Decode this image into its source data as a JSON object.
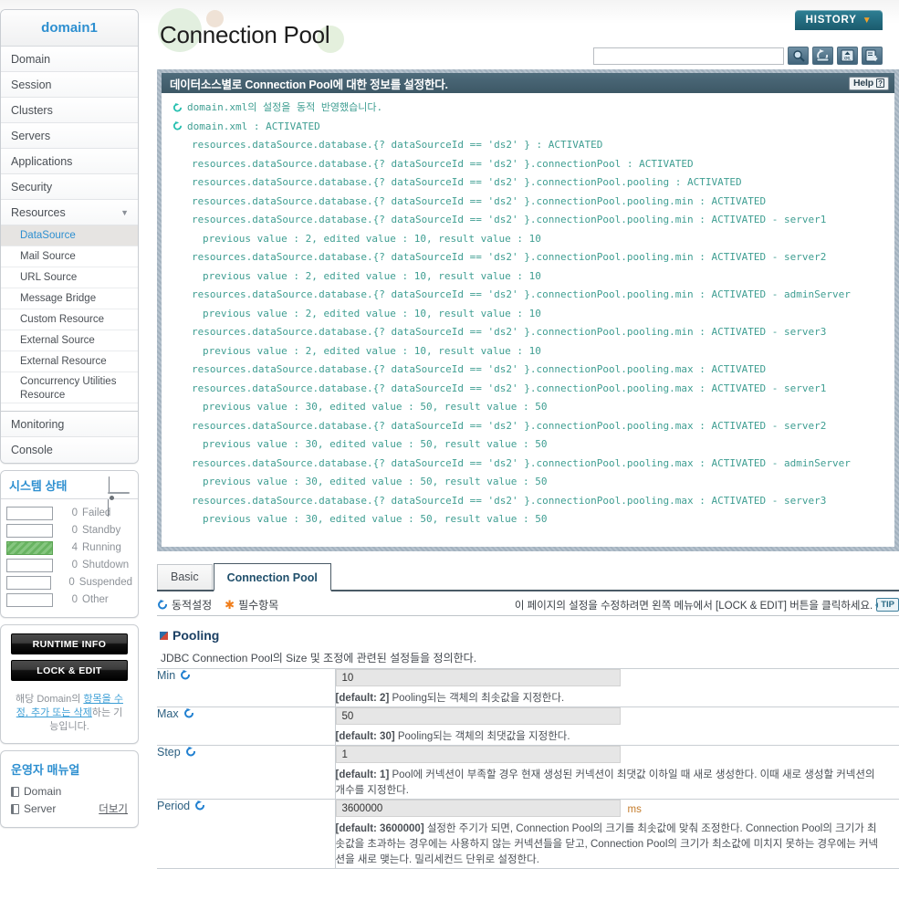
{
  "sidebar": {
    "domain_title": "domain1",
    "nav": [
      {
        "label": "Domain"
      },
      {
        "label": "Session"
      },
      {
        "label": "Clusters"
      },
      {
        "label": "Servers"
      },
      {
        "label": "Applications"
      },
      {
        "label": "Security"
      },
      {
        "label": "Resources",
        "expanded": true,
        "chevron": "chevron-down-icon"
      }
    ],
    "resources_sub": [
      {
        "label": "DataSource",
        "active": true
      },
      {
        "label": "Mail Source",
        "active": false
      },
      {
        "label": "URL Source",
        "active": false
      },
      {
        "label": "Message Bridge",
        "active": false
      },
      {
        "label": "Custom Resource",
        "active": false
      },
      {
        "label": "External Source",
        "active": false
      },
      {
        "label": "External Resource",
        "active": false
      },
      {
        "label": "Concurrency Utilities Resource",
        "active": false
      }
    ],
    "nav_tail": [
      {
        "label": "Monitoring"
      },
      {
        "label": "Console"
      }
    ],
    "system_status": {
      "title": "시스템 상태",
      "icon": "laptop-icon",
      "rows": [
        {
          "count": "0",
          "label": "Failed",
          "filled": false
        },
        {
          "count": "0",
          "label": "Standby",
          "filled": false
        },
        {
          "count": "4",
          "label": "Running",
          "filled": true
        },
        {
          "count": "0",
          "label": "Shutdown",
          "filled": false
        },
        {
          "count": "0",
          "label": "Suspended",
          "filled": false
        },
        {
          "count": "0",
          "label": "Other",
          "filled": false
        }
      ]
    },
    "buttons": {
      "runtime_info": "RUNTIME INFO",
      "lock_edit": "LOCK & EDIT"
    },
    "lock_note_1": "해당 Domain의 ",
    "lock_note_link": "항목을 수정, 추가 또는 삭제",
    "lock_note_2": "하는 기능입니다.",
    "manual": {
      "title": "운영자 매뉴얼",
      "items": [
        {
          "label": "Domain"
        },
        {
          "label": "Server"
        }
      ],
      "more": "더보기"
    }
  },
  "header": {
    "page_title": "Connection Pool",
    "history_label": "HISTORY",
    "history_caret": "chevron-down-icon",
    "search_value": "",
    "search_placeholder": "",
    "tools": [
      {
        "name": "search-icon"
      },
      {
        "name": "refresh-icon"
      },
      {
        "name": "xml-export-icon"
      },
      {
        "name": "save-download-icon"
      }
    ]
  },
  "log_panel": {
    "title": "데이터소스별로 Connection Pool에 대한 정보를 설정한다.",
    "help_label": "Help",
    "help_mark": "?",
    "lines": [
      {
        "indent": 1,
        "icon": true,
        "text": "domain.xml의 설정을 동적 반영했습니다."
      },
      {
        "indent": 1,
        "icon": true,
        "text": "domain.xml : ACTIVATED"
      },
      {
        "indent": 2,
        "icon": false,
        "text": "resources.dataSource.database.{? dataSourceId == 'ds2' } : ACTIVATED"
      },
      {
        "indent": 2,
        "icon": false,
        "text": "resources.dataSource.database.{? dataSourceId == 'ds2' }.connectionPool : ACTIVATED"
      },
      {
        "indent": 2,
        "icon": false,
        "text": "resources.dataSource.database.{? dataSourceId == 'ds2' }.connectionPool.pooling : ACTIVATED"
      },
      {
        "indent": 2,
        "icon": false,
        "text": "resources.dataSource.database.{? dataSourceId == 'ds2' }.connectionPool.pooling.min : ACTIVATED"
      },
      {
        "indent": 2,
        "icon": false,
        "text": "resources.dataSource.database.{? dataSourceId == 'ds2' }.connectionPool.pooling.min : ACTIVATED - server1"
      },
      {
        "indent": 3,
        "icon": false,
        "text": "previous value : 2, edited value : 10, result value : 10"
      },
      {
        "indent": 2,
        "icon": false,
        "text": "resources.dataSource.database.{? dataSourceId == 'ds2' }.connectionPool.pooling.min : ACTIVATED - server2"
      },
      {
        "indent": 3,
        "icon": false,
        "text": "previous value : 2, edited value : 10, result value : 10"
      },
      {
        "indent": 2,
        "icon": false,
        "text": "resources.dataSource.database.{? dataSourceId == 'ds2' }.connectionPool.pooling.min : ACTIVATED - adminServer"
      },
      {
        "indent": 3,
        "icon": false,
        "text": "previous value : 2, edited value : 10, result value : 10"
      },
      {
        "indent": 2,
        "icon": false,
        "text": "resources.dataSource.database.{? dataSourceId == 'ds2' }.connectionPool.pooling.min : ACTIVATED - server3"
      },
      {
        "indent": 3,
        "icon": false,
        "text": "previous value : 2, edited value : 10, result value : 10"
      },
      {
        "indent": 2,
        "icon": false,
        "text": "resources.dataSource.database.{? dataSourceId == 'ds2' }.connectionPool.pooling.max : ACTIVATED"
      },
      {
        "indent": 2,
        "icon": false,
        "text": "resources.dataSource.database.{? dataSourceId == 'ds2' }.connectionPool.pooling.max : ACTIVATED - server1"
      },
      {
        "indent": 3,
        "icon": false,
        "text": "previous value : 30, edited value : 50, result value : 50"
      },
      {
        "indent": 2,
        "icon": false,
        "text": "resources.dataSource.database.{? dataSourceId == 'ds2' }.connectionPool.pooling.max : ACTIVATED - server2"
      },
      {
        "indent": 3,
        "icon": false,
        "text": "previous value : 30, edited value : 50, result value : 50"
      },
      {
        "indent": 2,
        "icon": false,
        "text": "resources.dataSource.database.{? dataSourceId == 'ds2' }.connectionPool.pooling.max : ACTIVATED - adminServer"
      },
      {
        "indent": 3,
        "icon": false,
        "text": "previous value : 30, edited value : 50, result value : 50"
      },
      {
        "indent": 2,
        "icon": false,
        "text": "resources.dataSource.database.{? dataSourceId == 'ds2' }.connectionPool.pooling.max : ACTIVATED - server3"
      },
      {
        "indent": 3,
        "icon": false,
        "text": "previous value : 30, edited value : 50, result value : 50"
      }
    ]
  },
  "tabs": [
    {
      "label": "Basic",
      "active": false
    },
    {
      "label": "Connection Pool",
      "active": true
    }
  ],
  "legend": {
    "dynamic": "동적설정",
    "required": "필수항목",
    "tip_text": "이 페이지의 설정을 수정하려면 왼쪽 메뉴에서 [LOCK & EDIT] 버튼을 클릭하세요.",
    "tip_badge": "TIP"
  },
  "section": {
    "title": "Pooling",
    "description": "JDBC Connection Pool의 Size 및 조정에 관련된 설정들을 정의한다."
  },
  "fields": [
    {
      "label": "Min",
      "value": "10",
      "unit": "",
      "hint_default": "[default: 2]",
      "hint_text": "Pooling되는 객체의 최솟값을 지정한다."
    },
    {
      "label": "Max",
      "value": "50",
      "unit": "",
      "hint_default": "[default: 30]",
      "hint_text": "Pooling되는 객체의 최댓값을 지정한다."
    },
    {
      "label": "Step",
      "value": "1",
      "unit": "",
      "hint_default": "[default: 1]",
      "hint_text": "Pool에 커넥션이 부족할 경우 현재 생성된 커넥션이 최댓값 이하일 때 새로 생성한다. 이때 새로 생성할 커넥션의 개수를 지정한다."
    },
    {
      "label": "Period",
      "value": "3600000",
      "unit": "ms",
      "hint_default": "[default: 3600000]",
      "hint_text": "설정한 주기가 되면, Connection Pool의 크기를 최솟값에 맞춰 조정한다. Connection Pool의 크기가 최솟값을 초과하는 경우에는 사용하지 않는 커넥션들을 닫고, Connection Pool의 크기가 최소값에 미치지 못하는 경우에는 커넥션을 새로 맺는다. 밀리세컨드 단위로 설정한다."
    }
  ],
  "colors": {
    "accent_blue": "#2d8fd0",
    "log_teal": "#3f9e92",
    "panel_header": "#4e6b7b",
    "history_teal": "#246d81",
    "orange": "#f07d1a",
    "running_green": "#68b361"
  }
}
